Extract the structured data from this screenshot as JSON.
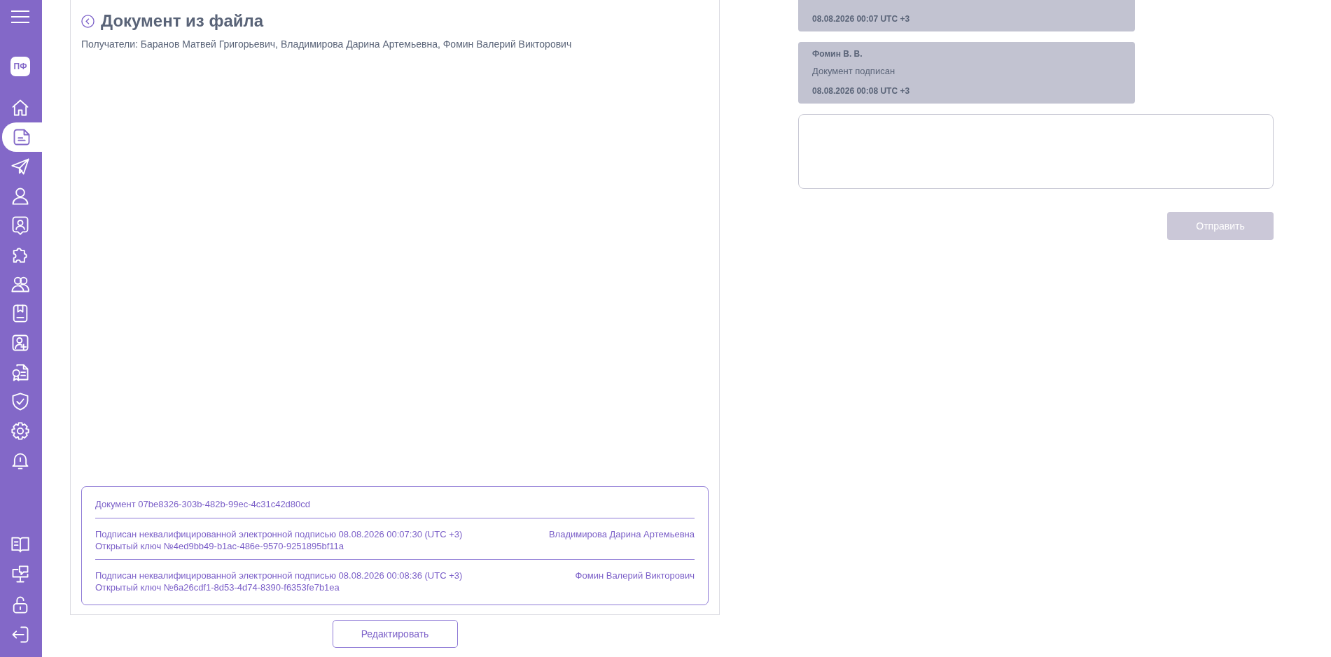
{
  "sidebar": {
    "logo": "ПФ",
    "items": [
      {
        "selected": false
      },
      {
        "selected": true
      },
      {
        "selected": false
      },
      {
        "selected": false
      },
      {
        "selected": false
      },
      {
        "selected": false
      },
      {
        "selected": false
      },
      {
        "selected": false
      },
      {
        "selected": false
      },
      {
        "selected": false
      },
      {
        "selected": false
      },
      {
        "selected": false
      },
      {
        "selected": false
      }
    ],
    "bottom_items": [
      {
        "selected": false
      },
      {
        "selected": false
      },
      {
        "selected": false
      },
      {
        "selected": false
      }
    ]
  },
  "document": {
    "title": "Документ из файла",
    "recipients": "Получатели: Баранов Матвей Григорьевич, Владимирова Дарина Артемьевна, Фомин Валерий Викторович",
    "signature_panel": {
      "document_id": "Документ 07be8326-303b-482b-99ec-4c31c42d80cd",
      "signatures": [
        {
          "text": "Подписан неквалифицированной электронной подписью 08.08.2026 00:07:30 (UTC +3)",
          "key": "Открытый ключ №4ed9bb49-b1ac-486e-9570-9251895bf11a",
          "signer": "Владимирова Дарина Артемьевна"
        },
        {
          "text": "Подписан неквалифицированной электронной подписью 08.08.2026 00:08:36 (UTC +3)",
          "key": "Открытый ключ №6a26cdf1-8d53-4d74-8390-f6353fe7b1ea",
          "signer": "Фомин Валерий Викторович"
        }
      ]
    },
    "edit_button": "Редактировать"
  },
  "messages": [
    {
      "time": "08.08.2026 00:07 UTC +3"
    },
    {
      "author": "Фомин В. В.",
      "text": "Документ подписан",
      "time": "08.08.2026 00:08 UTC +3"
    }
  ],
  "send_button": {
    "label": "Отправить",
    "disabled": true
  }
}
